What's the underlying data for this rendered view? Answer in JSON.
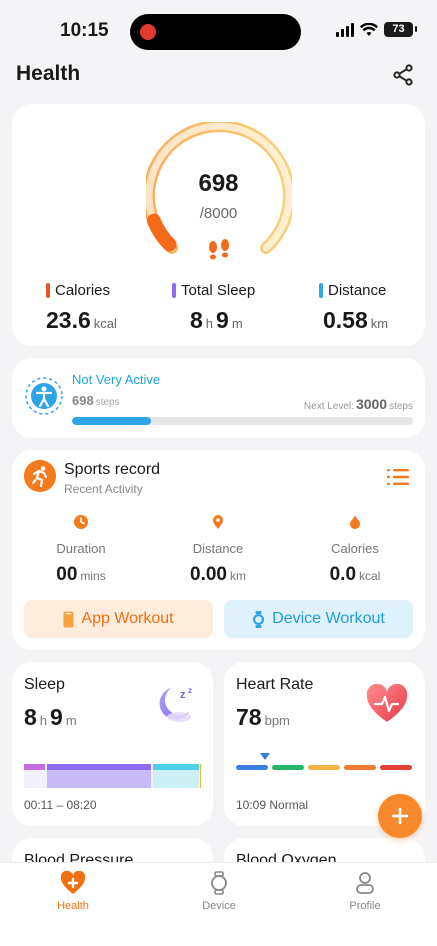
{
  "status_bar": {
    "time": "10:15",
    "battery": "73"
  },
  "header": {
    "title": "Health"
  },
  "steps": {
    "value": "698",
    "goal": "/8000",
    "progress_fraction": 0.087,
    "metrics": [
      {
        "label": "Calories",
        "value": "23.6",
        "unit": "kcal",
        "color": "#e8512a"
      },
      {
        "label": "Total Sleep",
        "value_h": "8",
        "unit_h": "h",
        "value_m": "9",
        "unit_m": "m",
        "color": "#8d6cf2"
      },
      {
        "label": "Distance",
        "value": "0.58",
        "unit": "km",
        "color": "#2aa8e8"
      }
    ]
  },
  "activity": {
    "level": "Not Very Active",
    "steps": "698",
    "steps_unit": "steps",
    "next_label": "Next Level:",
    "next_value": "3000",
    "next_unit": "steps",
    "progress_fraction": 0.233
  },
  "sports": {
    "title": "Sports record",
    "subtitle": "Recent Activity",
    "stats": [
      {
        "label": "Duration",
        "value": "00",
        "unit": "mins",
        "icon": "clock-icon"
      },
      {
        "label": "Distance",
        "value": "0.00",
        "unit": "km",
        "icon": "location-pin-icon"
      },
      {
        "label": "Calories",
        "value": "0.0",
        "unit": "kcal",
        "icon": "flame-icon"
      }
    ],
    "app_workout": "App Workout",
    "device_workout": "Device Workout"
  },
  "sleep": {
    "title": "Sleep",
    "hours": "8",
    "hours_unit": "h",
    "minutes": "9",
    "minutes_unit": "m",
    "time_range": "00:11 – 08:20"
  },
  "heart": {
    "title": "Heart Rate",
    "value": "78",
    "unit": "bpm",
    "status": "10:09 Normal",
    "zone_colors": [
      "#3d7fe0",
      "#26b56a",
      "#f5b544",
      "#ef7c35",
      "#e0423a"
    ]
  },
  "peek": {
    "blood_pressure": "Blood Pressure",
    "blood_oxygen": "Blood Oxygen"
  },
  "tabs": [
    {
      "label": "Health",
      "icon": "health-cross-icon",
      "active": true
    },
    {
      "label": "Device",
      "icon": "watch-icon",
      "active": false
    },
    {
      "label": "Profile",
      "icon": "person-icon",
      "active": false
    }
  ],
  "colors": {
    "accent": "#f07012",
    "blue": "#1fa3e0"
  }
}
